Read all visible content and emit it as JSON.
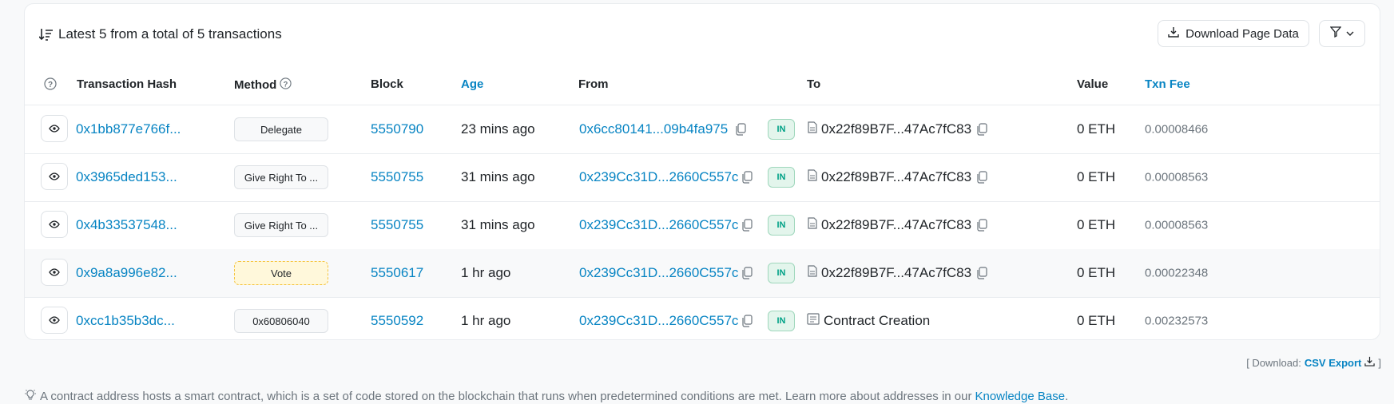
{
  "header": {
    "summary": "Latest 5 from a total of 5 transactions",
    "download_label": "Download Page Data"
  },
  "columns": {
    "hash": "Transaction Hash",
    "method": "Method",
    "block": "Block",
    "age": "Age",
    "from": "From",
    "to": "To",
    "value": "Value",
    "fee": "Txn Fee"
  },
  "rows": [
    {
      "hash": "0x1bb877e766f...",
      "method": "Delegate",
      "block": "5550790",
      "age": "23 mins ago",
      "from": "0x6cc80141...09b4fa975",
      "direction": "IN",
      "to": "0x22f89B7F...47Ac7fC83",
      "value": "0 ETH",
      "fee": "0.00008466"
    },
    {
      "hash": "0x3965ded153...",
      "method": "Give Right To ...",
      "block": "5550755",
      "age": "31 mins ago",
      "from": "0x239Cc31D...2660C557c",
      "direction": "IN",
      "to": "0x22f89B7F...47Ac7fC83",
      "value": "0 ETH",
      "fee": "0.00008563"
    },
    {
      "hash": "0x4b33537548...",
      "method": "Give Right To ...",
      "block": "5550755",
      "age": "31 mins ago",
      "from": "0x239Cc31D...2660C557c",
      "direction": "IN",
      "to": "0x22f89B7F...47Ac7fC83",
      "value": "0 ETH",
      "fee": "0.00008563"
    },
    {
      "hash": "0x9a8a996e82...",
      "method": "Vote",
      "block": "5550617",
      "age": "1 hr ago",
      "from": "0x239Cc31D...2660C557c",
      "direction": "IN",
      "to": "0x22f89B7F...47Ac7fC83",
      "value": "0 ETH",
      "fee": "0.00022348"
    },
    {
      "hash": "0xcc1b35b3dc...",
      "method": "0x60806040",
      "block": "5550592",
      "age": "1 hr ago",
      "from": "0x239Cc31D...2660C557c",
      "direction": "IN",
      "to": "Contract Creation",
      "value": "0 ETH",
      "fee": "0.00232573"
    }
  ],
  "footer": {
    "download_prefix": "[ Download:",
    "csv_label": "CSV Export",
    "download_suffix": "]",
    "note": "A contract address hosts a smart contract, which is a set of code stored on the blockchain that runs when predetermined conditions are met. Learn more about addresses in our",
    "kb_link": "Knowledge Base",
    "note_end": "."
  },
  "colors": {
    "link": "#0784c3",
    "in_badge": "#00a186",
    "vote_highlight": "#fff8db"
  },
  "icons": [
    "sort-icon",
    "download-icon",
    "filter-icon",
    "chevron-down-icon",
    "help-icon",
    "eye-icon",
    "copy-icon",
    "document-icon",
    "contract-icon",
    "lightbulb-icon"
  ]
}
